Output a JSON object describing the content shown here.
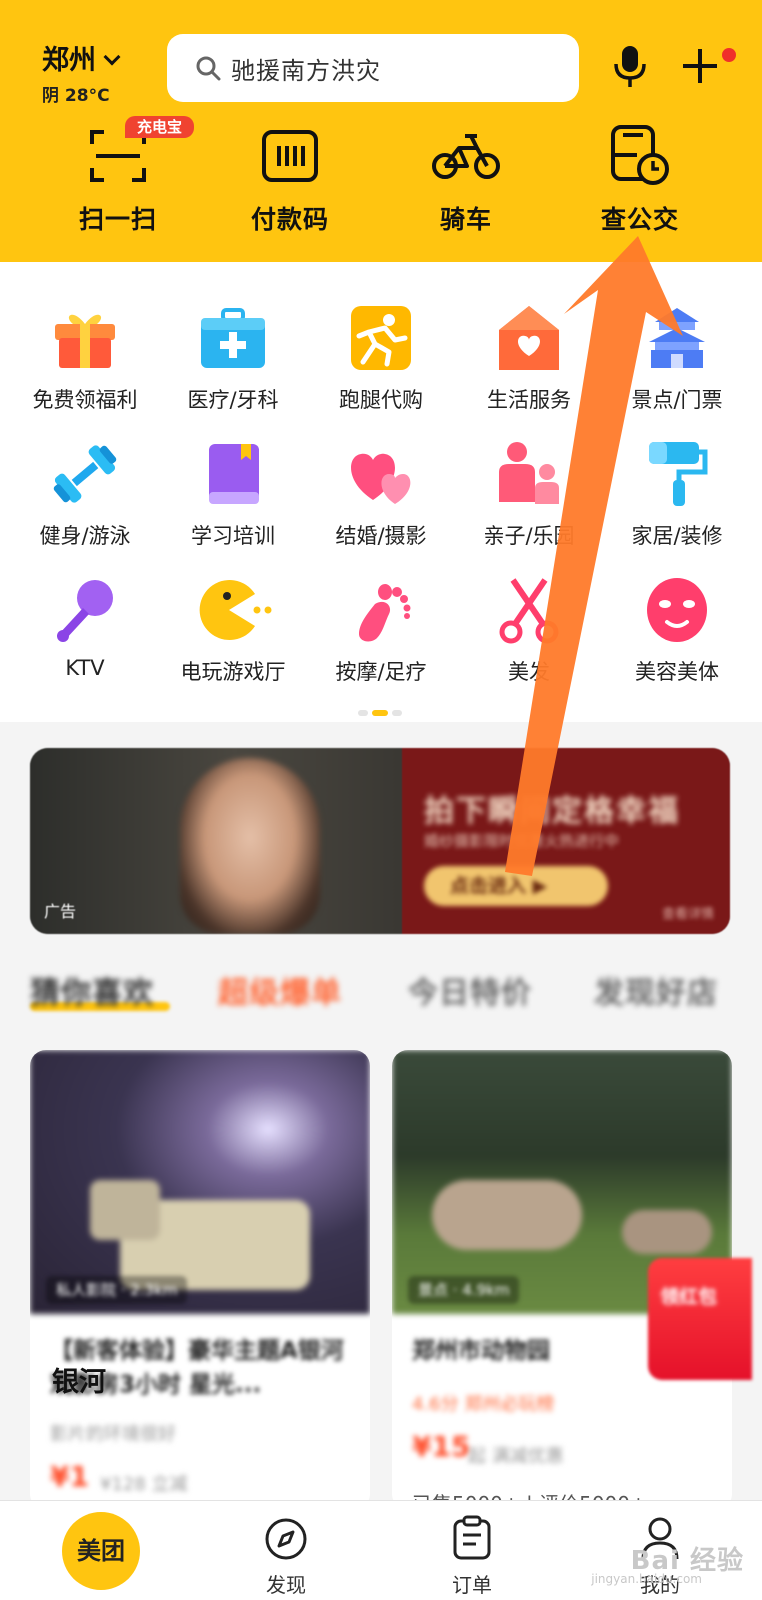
{
  "header": {
    "city": "郑州",
    "weather": "阴 28°C",
    "search_placeholder": "驰援南方洪灾",
    "quick_actions": [
      {
        "label": "扫一扫",
        "icon": "scan-icon",
        "badge": "充电宝"
      },
      {
        "label": "付款码",
        "icon": "barcode-icon"
      },
      {
        "label": "骑车",
        "icon": "bicycle-icon"
      },
      {
        "label": "查公交",
        "icon": "bus-clock-icon"
      }
    ]
  },
  "categories": [
    {
      "label": "免费领福利",
      "icon": "gift-icon"
    },
    {
      "label": "医疗/牙科",
      "icon": "medical-kit-icon"
    },
    {
      "label": "跑腿代购",
      "icon": "runner-icon"
    },
    {
      "label": "生活服务",
      "icon": "house-heart-icon"
    },
    {
      "label": "景点/门票",
      "icon": "temple-icon"
    },
    {
      "label": "健身/游泳",
      "icon": "dumbbell-icon"
    },
    {
      "label": "学习培训",
      "icon": "book-icon"
    },
    {
      "label": "结婚/摄影",
      "icon": "hearts-icon"
    },
    {
      "label": "亲子/乐园",
      "icon": "parent-child-icon"
    },
    {
      "label": "家居/装修",
      "icon": "paint-roller-icon"
    },
    {
      "label": "KTV",
      "icon": "microphone-icon"
    },
    {
      "label": "电玩游戏厅",
      "icon": "pacman-icon"
    },
    {
      "label": "按摩/足疗",
      "icon": "foot-icon"
    },
    {
      "label": "美发",
      "icon": "scissors-icon"
    },
    {
      "label": "美容美体",
      "icon": "face-mask-icon"
    }
  ],
  "banner": {
    "ad_label": "广告",
    "title": "拍下瞬间定格幸福",
    "subtitle": "婚纱摄影限时优惠火热进行中",
    "button": "点击进入 ▶",
    "corner": "查看详情"
  },
  "feed_tabs": [
    "猜你喜欢",
    "超级爆单",
    "今日特价",
    "发现好店"
  ],
  "cards": [
    {
      "tag": "私人影院 · 2.3km",
      "title": "【新客体验】豪华主题A银河观影房3小时 星光...",
      "clear_title": "银河",
      "meta": "影片的环境很好",
      "price": "¥1",
      "extra": "¥128  立减"
    },
    {
      "tag": "景点 · 4.9km",
      "title": "郑州市动物园",
      "meta": "4.6分  郑州必玩榜",
      "price": "¥15",
      "extra": "起  满减优惠",
      "sold": "已售5000+ | 评价5000+"
    }
  ],
  "float_ad": "领红包",
  "bottom_nav": [
    {
      "label": "美团",
      "icon": "meituan-logo"
    },
    {
      "label": "发现",
      "icon": "compass-icon"
    },
    {
      "label": "订单",
      "icon": "order-list-icon"
    },
    {
      "label": "我的",
      "icon": "user-icon"
    }
  ],
  "watermark": {
    "text": "Bai 经验",
    "sub": "jingyan.baidu.com"
  },
  "colors": {
    "brand_yellow": "#ffc510",
    "arrow": "#ff7a2a",
    "badge_red": "#f04330"
  }
}
